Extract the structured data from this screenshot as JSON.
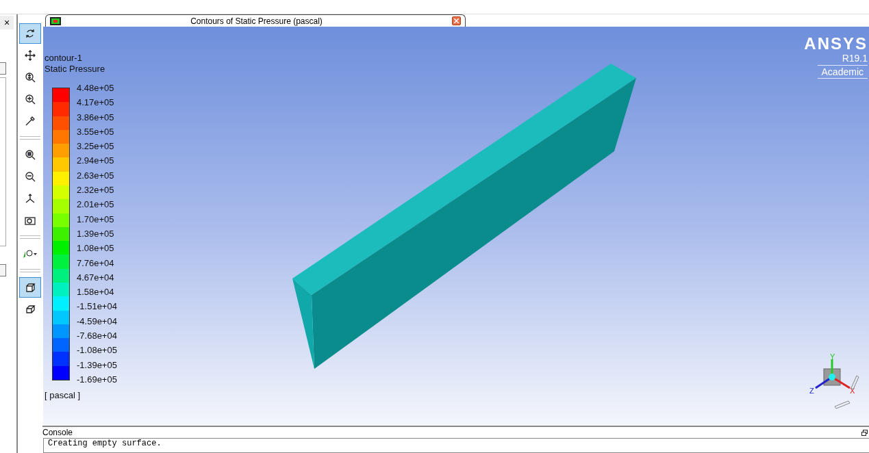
{
  "left_panel": {
    "close": "×"
  },
  "toolbar": {
    "groups": [
      [
        {
          "kind": "rotate",
          "selected": true
        },
        {
          "kind": "pan",
          "selected": false
        },
        {
          "kind": "zoom-fit",
          "selected": false
        },
        {
          "kind": "zoom-in",
          "selected": false
        },
        {
          "kind": "probe",
          "selected": false
        }
      ],
      [
        {
          "kind": "zoom-box",
          "selected": false
        },
        {
          "kind": "zoom-out",
          "selected": false
        },
        {
          "kind": "axes",
          "selected": false
        },
        {
          "kind": "camera",
          "selected": false
        }
      ],
      [
        {
          "kind": "view-menu",
          "selected": false
        }
      ],
      [
        {
          "kind": "solid-box",
          "selected": true
        },
        {
          "kind": "wire-box",
          "selected": false
        }
      ]
    ]
  },
  "graphics_window": {
    "title": "Contours of Static Pressure (pascal)",
    "legend": {
      "name": "contour-1",
      "quantity": "Static Pressure",
      "unit": "[ pascal ]",
      "entries": [
        {
          "value": "4.48e+05",
          "color": "#ff0000"
        },
        {
          "value": "4.17e+05",
          "color": "#ff2a00"
        },
        {
          "value": "3.86e+05",
          "color": "#ff5000"
        },
        {
          "value": "3.55e+05",
          "color": "#ff7600"
        },
        {
          "value": "3.25e+05",
          "color": "#ff9e00"
        },
        {
          "value": "2.94e+05",
          "color": "#ffc800"
        },
        {
          "value": "2.63e+05",
          "color": "#fff000"
        },
        {
          "value": "2.32e+05",
          "color": "#d4ff00"
        },
        {
          "value": "2.01e+05",
          "color": "#a6ff00"
        },
        {
          "value": "1.70e+05",
          "color": "#78ff00"
        },
        {
          "value": "1.39e+05",
          "color": "#3cf000"
        },
        {
          "value": "1.08e+05",
          "color": "#00f000"
        },
        {
          "value": "7.76e+04",
          "color": "#00f040"
        },
        {
          "value": "4.67e+04",
          "color": "#00f080"
        },
        {
          "value": "1.58e+04",
          "color": "#00f0c0"
        },
        {
          "value": "-1.51e+04",
          "color": "#00f0ff"
        },
        {
          "value": "-4.59e+04",
          "color": "#00c8ff"
        },
        {
          "value": "-7.68e+04",
          "color": "#0096ff"
        },
        {
          "value": "-1.08e+05",
          "color": "#0064ff"
        },
        {
          "value": "-1.39e+05",
          "color": "#0032ff"
        },
        {
          "value": "-1.69e+05",
          "color": "#0000ff"
        }
      ]
    },
    "brand": {
      "name": "ANSYS",
      "version": "R19.1",
      "edition": "Academic"
    },
    "triad": {
      "x": "X",
      "y": "Y",
      "z": "Z"
    }
  },
  "console": {
    "title": "Console",
    "lines": [
      "Creating empty surface."
    ]
  }
}
